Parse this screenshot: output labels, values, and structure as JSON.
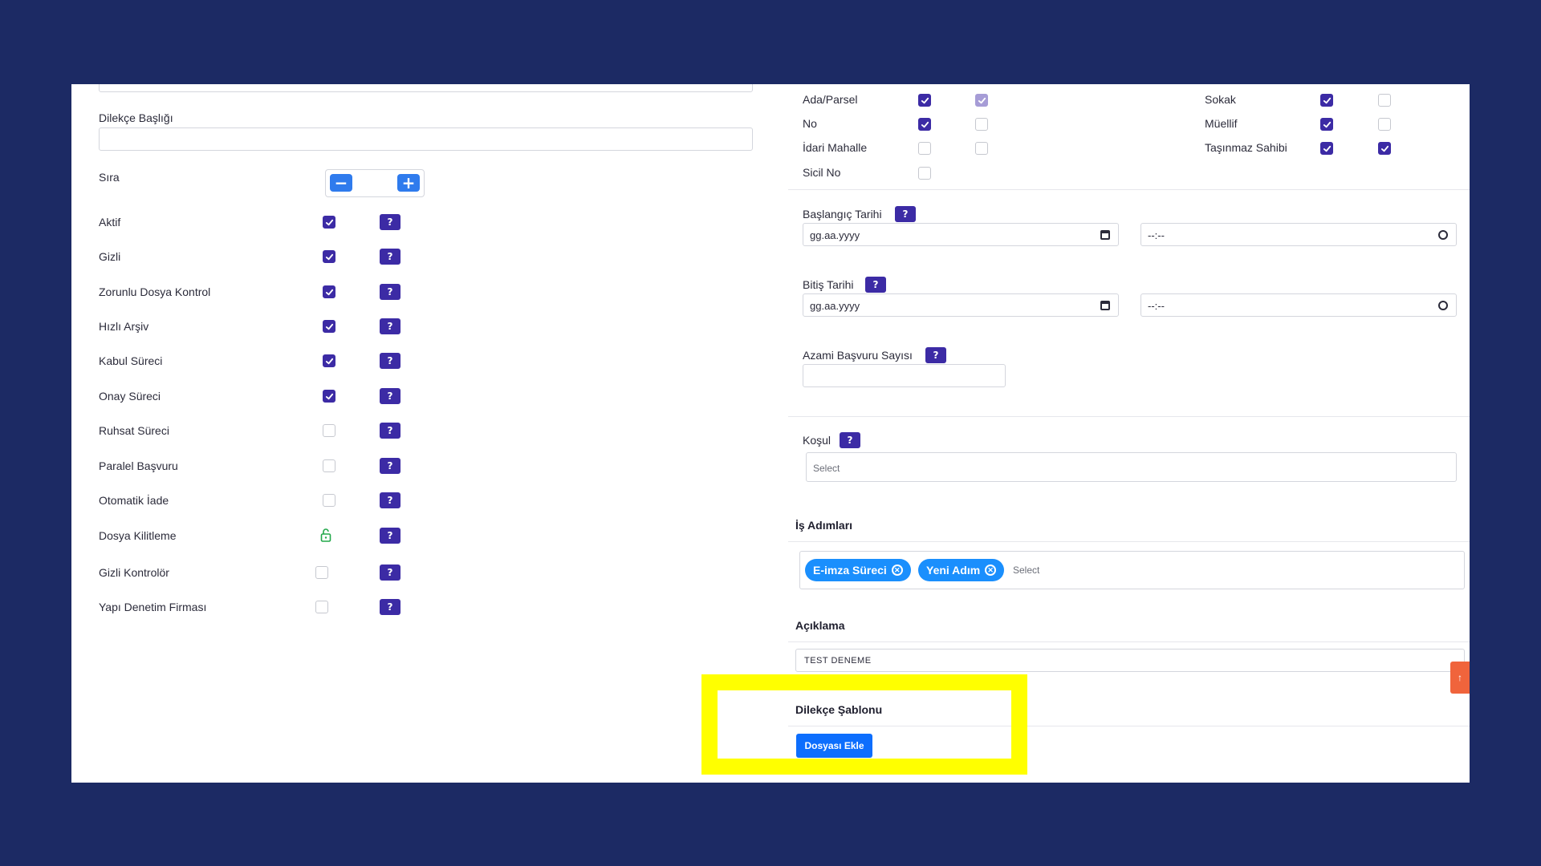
{
  "left": {
    "dilekce_basligi_label": "Dilekçe Başlığı",
    "dilekce_basligi_value": "",
    "sira_label": "Sıra",
    "sira_minus": "−",
    "sira_plus": "+",
    "rows": [
      {
        "label": "Aktif",
        "checked": true
      },
      {
        "label": "Gizli",
        "checked": true
      },
      {
        "label": "Zorunlu Dosya Kontrol",
        "checked": true
      },
      {
        "label": "Hızlı Arşiv",
        "checked": true
      },
      {
        "label": "Kabul Süreci",
        "checked": true
      },
      {
        "label": "Onay Süreci",
        "checked": true
      },
      {
        "label": "Ruhsat Süreci",
        "checked": false
      },
      {
        "label": "Paralel Başvuru",
        "checked": false
      },
      {
        "label": "Otomatik İade",
        "checked": false
      },
      {
        "label": "Dosya Kilitleme",
        "checked": false
      },
      {
        "label": "Gizli Kontrolör",
        "checked": false
      },
      {
        "label": "Yapı Denetim Firması",
        "checked": false
      }
    ],
    "help": "?"
  },
  "right": {
    "fields_a": [
      {
        "label": "Ada/Parsel",
        "c1": true,
        "c2": "disabled"
      },
      {
        "label": "No",
        "c1": true,
        "c2": false
      },
      {
        "label": "İdari Mahalle",
        "c1": false,
        "c2": false
      },
      {
        "label": "Sicil No",
        "c1": false
      }
    ],
    "fields_b": [
      {
        "label": "Sokak",
        "c1": true,
        "c2": false
      },
      {
        "label": "Müellif",
        "c1": true,
        "c2": false
      },
      {
        "label": "Taşınmaz Sahibi",
        "c1": true,
        "c2": true
      }
    ],
    "baslangic_label": "Başlangıç Tarihi",
    "bitis_label": "Bitiş Tarihi",
    "date_placeholder": "gg.aa.yyyy",
    "time_placeholder": "--:--",
    "azami_label": "Azami Başvuru Sayısı",
    "kosul_label": "Koşul",
    "select_placeholder": "Select",
    "is_adimlari_label": "İş Adımları",
    "tags": [
      "E-imza Süreci",
      "Yeni Adım"
    ],
    "aciklama_label": "Açıklama",
    "aciklama_value": "TEST DENEME",
    "sablon_label": "Dilekçe Şablonu",
    "dosya_ekle": "Dosyası Ekle",
    "help": "?"
  },
  "colors": {
    "accent": "#3c2ba5",
    "primary": "#0d6efd",
    "tag": "#1a8ffd",
    "background": "#1c2a64",
    "highlight": "#ffff00"
  }
}
